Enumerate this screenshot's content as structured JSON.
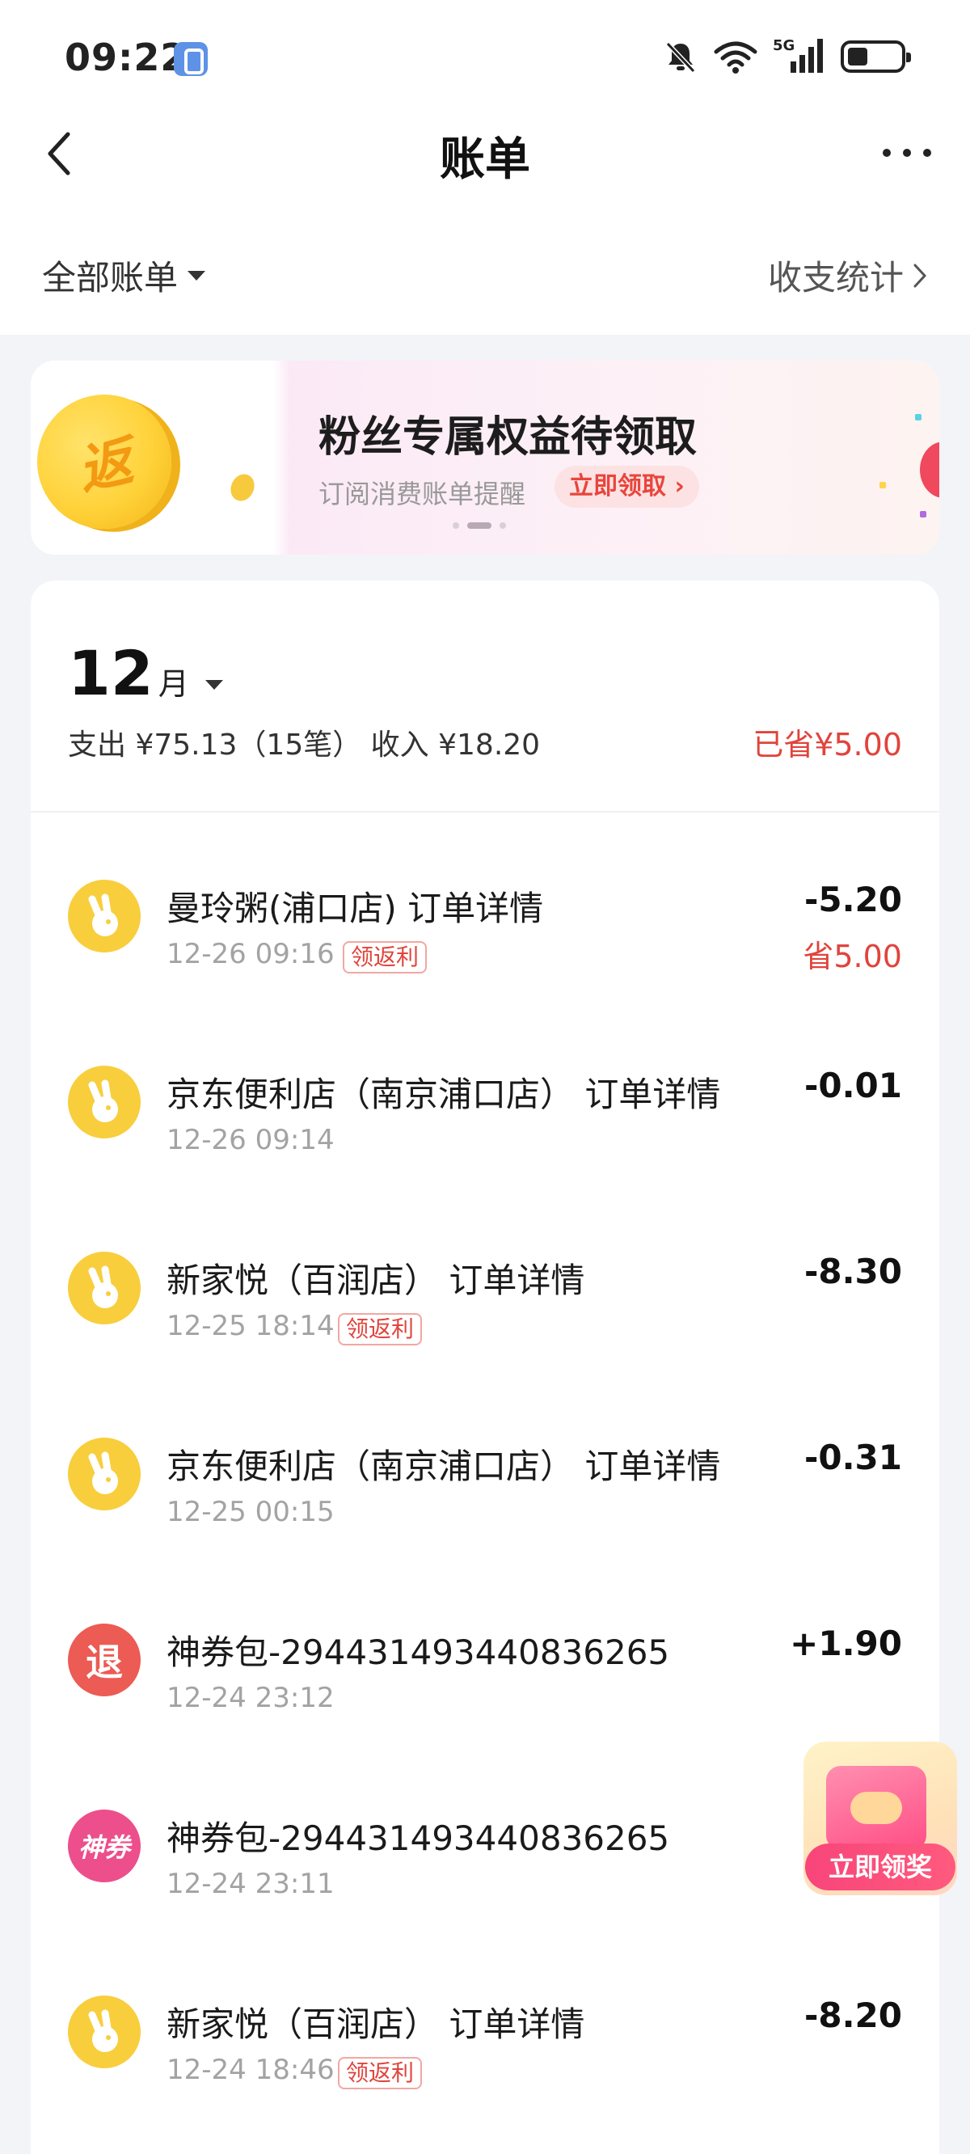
{
  "status_bar": {
    "time": "09:22",
    "app_icon": "vpn-shield-icon",
    "icons": [
      "mute-bell-icon",
      "wifi-icon",
      "5g-signal-icon",
      "battery-icon"
    ],
    "network_label": "5G"
  },
  "header": {
    "title": "账单",
    "back_icon": "chevron-left-icon",
    "more_icon": "more-dots-icon"
  },
  "filter": {
    "all_bills_label": "全部账单",
    "stats_label": "收支统计",
    "stats_chevron": "›"
  },
  "banner": {
    "coin_char": "返",
    "title": "粉丝专属权益待领取",
    "subtitle": "订阅消费账单提醒",
    "cta_label": "立即领取 ›",
    "page_count": 3,
    "active_page": 2
  },
  "bill": {
    "month_num": "12",
    "month_unit": "月",
    "summary": "支出 ¥75.13（15笔） 收入 ¥18.20",
    "saved_total": "已省¥5.00",
    "rows": [
      {
        "icon": "rabbit-logo-icon",
        "title": "曼玲粥(浦口店) 订单详情",
        "time": "12-26 09:16",
        "tag": "领返利",
        "amount": "-5.20",
        "saved": "省5.00"
      },
      {
        "icon": "rabbit-logo-icon",
        "title": "京东便利店（南京浦口店） 订单详情",
        "time": "12-26 09:14",
        "tag": "",
        "amount": "-0.01",
        "saved": ""
      },
      {
        "icon": "rabbit-logo-icon",
        "title": "新家悦（百润店） 订单详情",
        "time": "12-25 18:14",
        "tag": "领返利",
        "amount": "-8.30",
        "saved": ""
      },
      {
        "icon": "rabbit-logo-icon",
        "title": "京东便利店（南京浦口店） 订单详情",
        "time": "12-25 00:15",
        "tag": "",
        "amount": "-0.31",
        "saved": ""
      },
      {
        "icon": "refund-icon",
        "icon_text": "退",
        "title": "神券包-2944314934408362​65",
        "time": "12-24 23:12",
        "tag": "",
        "amount": "+1.90",
        "saved": ""
      },
      {
        "icon": "coupon-icon",
        "icon_text": "神券",
        "title": "神券包-294431493440836265",
        "time": "12-24 23:11",
        "tag": "",
        "amount": "",
        "saved": ""
      },
      {
        "icon": "rabbit-logo-icon",
        "title": "新家悦（百润店） 订单详情",
        "time": "12-24 18:46",
        "tag": "领返利",
        "amount": "-8.20",
        "saved": ""
      }
    ]
  },
  "floating_reward": {
    "icon": "gift-box-icon",
    "cta_label": "立即领奖"
  },
  "colors": {
    "accent_red": "#e0443c",
    "rabbit_yellow": "#f8ce3d",
    "refund_red": "#ec5b54",
    "coupon_pink": "#ec4f8b",
    "page_bg": "#f3f4f8"
  }
}
